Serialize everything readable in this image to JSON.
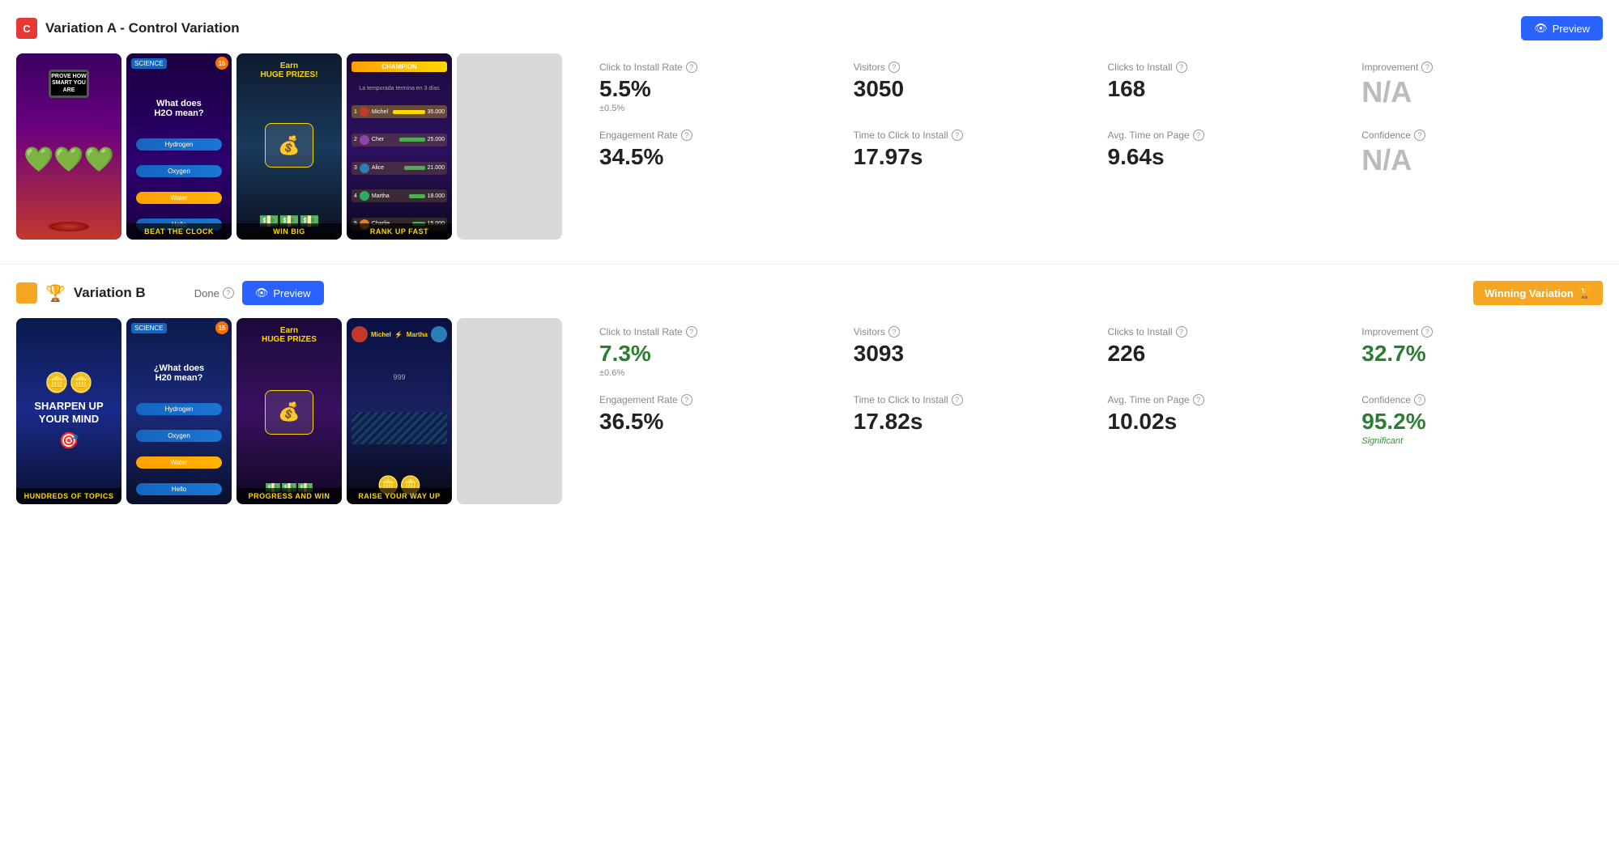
{
  "variationA": {
    "badge_letter": "C",
    "title": "Variation A - Control Variation",
    "preview_label": "Preview",
    "thumbnails": [
      {
        "id": "a1",
        "main_text": "PROVE HOW SMART YOU ARE",
        "label": null
      },
      {
        "id": "a2",
        "main_text": "What does H2O mean?",
        "label": "BEAT THE CLOCK",
        "science": true,
        "num": 15
      },
      {
        "id": "a3",
        "main_text": "Earn HUGE PRIZES!",
        "label": "WIN BIG"
      },
      {
        "id": "a4",
        "main_text": "CHAMPION",
        "label": "RANK UP FAST"
      }
    ],
    "stats": {
      "click_to_install_rate": {
        "label": "Click to Install Rate",
        "value": "5.5%",
        "sub": "±0.5%"
      },
      "visitors": {
        "label": "Visitors",
        "value": "3050"
      },
      "clicks_to_install": {
        "label": "Clicks to Install",
        "value": "168"
      },
      "improvement": {
        "label": "Improvement",
        "value": "N/A",
        "gray": true
      },
      "engagement_rate": {
        "label": "Engagement Rate",
        "value": "34.5%"
      },
      "time_to_click": {
        "label": "Time to Click to Install",
        "value": "17.97s"
      },
      "avg_time_on_page": {
        "label": "Avg. Time on Page",
        "value": "9.64s"
      },
      "confidence": {
        "label": "Confidence",
        "value": "N/A",
        "gray": true
      }
    }
  },
  "variationB": {
    "badge_color": "gold",
    "title": "Variation B",
    "done_label": "Done",
    "preview_label": "Preview",
    "winning_label": "Winning Variation",
    "thumbnails": [
      {
        "id": "b1",
        "main_text": "SHARPEN UP YOUR MIND",
        "label": "HUNDREDS OF TOPICS"
      },
      {
        "id": "b2",
        "main_text": "¿What does H20 mean?",
        "label": null,
        "science": true,
        "num": 15
      },
      {
        "id": "b3",
        "main_text": "Earn HUGE PRIZES",
        "label": "PROGRESS AND WIN"
      },
      {
        "id": "b4",
        "main_text": "RAISE YOUR WAY UP",
        "label": "RAISE YOUR WAY UP"
      }
    ],
    "stats": {
      "click_to_install_rate": {
        "label": "Click to Install Rate",
        "value": "7.3%",
        "sub": "±0.6%",
        "green": true
      },
      "visitors": {
        "label": "Visitors",
        "value": "3093"
      },
      "clicks_to_install": {
        "label": "Clicks to Install",
        "value": "226"
      },
      "improvement": {
        "label": "Improvement",
        "value": "32.7%",
        "green": true
      },
      "engagement_rate": {
        "label": "Engagement Rate",
        "value": "36.5%"
      },
      "time_to_click": {
        "label": "Time to Click to Install",
        "value": "17.82s"
      },
      "avg_time_on_page": {
        "label": "Avg. Time on Page",
        "value": "10.02s"
      },
      "confidence": {
        "label": "Confidence",
        "value": "95.2%",
        "sub": "Significant",
        "green": true
      }
    }
  },
  "icons": {
    "eye": "👁",
    "trophy": "🏆",
    "info": "?"
  }
}
